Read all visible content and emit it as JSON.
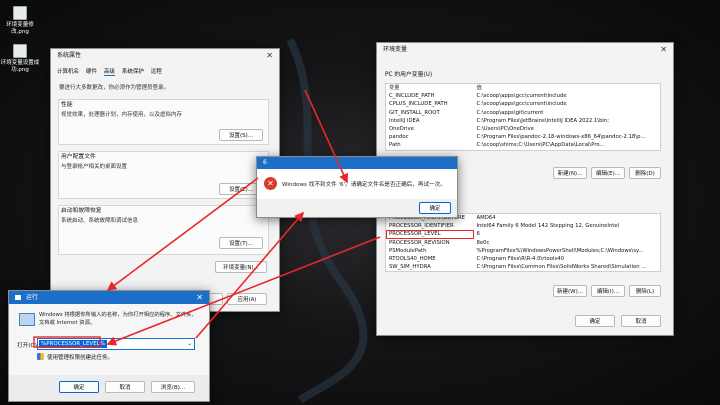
{
  "desktop": {
    "icons": [
      {
        "label": "环境变量修改.png"
      },
      {
        "label": "环境变量设置成功.png"
      }
    ]
  },
  "sysprops": {
    "title": "系统属性",
    "tabs": [
      "计算机名",
      "硬件",
      "高级",
      "系统保护",
      "远程"
    ],
    "admin_note": "要进行大多数更改，你必须作为管理员登录。",
    "perf": {
      "label": "性能",
      "desc": "视觉效果，处理器计划，内存使用，以及虚拟内存",
      "button": "设置(S)..."
    },
    "profile": {
      "label": "用户配置文件",
      "desc": "与登录帐户相关的桌面设置",
      "button": "设置(E)..."
    },
    "startup": {
      "label": "启动和故障恢复",
      "desc": "系统启动、系统故障和调试信息",
      "button": "设置(T)..."
    },
    "env_button": "环境变量(N)...",
    "ok": "确定",
    "cancel": "取消",
    "apply": "应用(A)"
  },
  "envvars": {
    "title": "环境变量",
    "user_section": "PC 的用户变量(U)",
    "col_var": "变量",
    "col_val": "值",
    "user_vars": [
      {
        "name": "C_INCLUDE_PATH",
        "value": "C:\\scoop\\apps\\gcc\\current\\include"
      },
      {
        "name": "CPLUS_INCLUDE_PATH",
        "value": "C:\\scoop\\apps\\gcc\\current\\include"
      },
      {
        "name": "GIT_INSTALL_ROOT",
        "value": "C:\\scoop\\apps\\git\\current"
      },
      {
        "name": "IntelliJ IDEA",
        "value": "C:\\Program Files\\JetBrains\\IntelliJ IDEA 2022.1\\bin;"
      },
      {
        "name": "OneDrive",
        "value": "C:\\Users\\PC\\OneDrive"
      },
      {
        "name": "pandoc",
        "value": "C:\\Program Files\\pandoc-2.18-windows-x86_64\\pandoc-2.18\\p..."
      },
      {
        "name": "Path",
        "value": "C:\\scoop\\shims;C:\\Users\\PC\\AppData\\Local\\Pro..."
      }
    ],
    "user_buttons": {
      "new": "新建(N)...",
      "edit": "编辑(E)...",
      "delete": "删除(D)"
    },
    "sys_vars": [
      {
        "name": "PROCESSOR_ARCHITECTURE",
        "value": "AMD64"
      },
      {
        "name": "PROCESSOR_IDENTIFIER",
        "value": "Intel64 Family 6 Model 142 Stepping 12, GenuineIntel"
      },
      {
        "name": "PROCESSOR_LEVEL",
        "value": "6"
      },
      {
        "name": "PROCESSOR_REVISION",
        "value": "8e0c"
      },
      {
        "name": "PSModulePath",
        "value": "%ProgramFiles%\\WindowsPowerShell\\Modules;C:\\Windows\\sy..."
      },
      {
        "name": "RTOOLS40_HOME",
        "value": "C:\\Program Files\\R\\R-4.0\\rtools40"
      },
      {
        "name": "SW_SIM_HYDRA",
        "value": "C:\\Program Files\\Common Files\\SolidWorks Shared\\Simulation ..."
      }
    ],
    "sys_buttons": {
      "new": "新建(W)...",
      "edit": "编辑(I)...",
      "delete": "删除(L)"
    },
    "ok": "确定",
    "cancel": "取消"
  },
  "error_dialog": {
    "title": "6",
    "message": "Windows 找不到文件 '6'。请确定文件名是否正确后，再试一次。",
    "ok": "确定"
  },
  "run_dialog": {
    "title": "运行",
    "desc": "Windows 将根据你所输入的名称，为你打开相应的程序、文件夹、文档或 Internet 资源。",
    "open_label": "打开(O):",
    "input_value": "%PROCESSOR_LEVEL%",
    "admin_note": "使用管理权限创建此任务。",
    "ok": "确定",
    "cancel": "取消",
    "browse": "浏览(B)..."
  },
  "colors": {
    "annotation": "#e8262b",
    "title_blue": "#1c6fc9",
    "selection": "#0a64d8"
  }
}
